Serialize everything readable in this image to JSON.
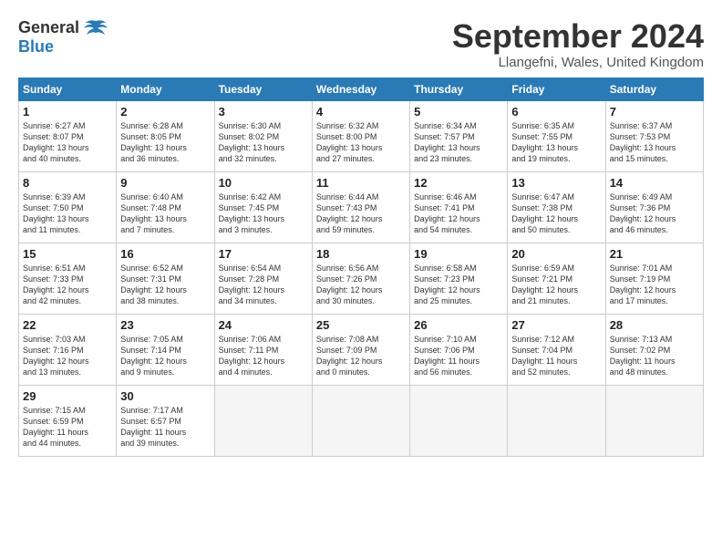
{
  "header": {
    "logo_general": "General",
    "logo_blue": "Blue",
    "month_title": "September 2024",
    "location": "Llangefni, Wales, United Kingdom"
  },
  "weekdays": [
    "Sunday",
    "Monday",
    "Tuesday",
    "Wednesday",
    "Thursday",
    "Friday",
    "Saturday"
  ],
  "weeks": [
    [
      {
        "day": "1",
        "lines": [
          "Sunrise: 6:27 AM",
          "Sunset: 8:07 PM",
          "Daylight: 13 hours",
          "and 40 minutes."
        ]
      },
      {
        "day": "2",
        "lines": [
          "Sunrise: 6:28 AM",
          "Sunset: 8:05 PM",
          "Daylight: 13 hours",
          "and 36 minutes."
        ]
      },
      {
        "day": "3",
        "lines": [
          "Sunrise: 6:30 AM",
          "Sunset: 8:02 PM",
          "Daylight: 13 hours",
          "and 32 minutes."
        ]
      },
      {
        "day": "4",
        "lines": [
          "Sunrise: 6:32 AM",
          "Sunset: 8:00 PM",
          "Daylight: 13 hours",
          "and 27 minutes."
        ]
      },
      {
        "day": "5",
        "lines": [
          "Sunrise: 6:34 AM",
          "Sunset: 7:57 PM",
          "Daylight: 13 hours",
          "and 23 minutes."
        ]
      },
      {
        "day": "6",
        "lines": [
          "Sunrise: 6:35 AM",
          "Sunset: 7:55 PM",
          "Daylight: 13 hours",
          "and 19 minutes."
        ]
      },
      {
        "day": "7",
        "lines": [
          "Sunrise: 6:37 AM",
          "Sunset: 7:53 PM",
          "Daylight: 13 hours",
          "and 15 minutes."
        ]
      }
    ],
    [
      {
        "day": "8",
        "lines": [
          "Sunrise: 6:39 AM",
          "Sunset: 7:50 PM",
          "Daylight: 13 hours",
          "and 11 minutes."
        ]
      },
      {
        "day": "9",
        "lines": [
          "Sunrise: 6:40 AM",
          "Sunset: 7:48 PM",
          "Daylight: 13 hours",
          "and 7 minutes."
        ]
      },
      {
        "day": "10",
        "lines": [
          "Sunrise: 6:42 AM",
          "Sunset: 7:45 PM",
          "Daylight: 13 hours",
          "and 3 minutes."
        ]
      },
      {
        "day": "11",
        "lines": [
          "Sunrise: 6:44 AM",
          "Sunset: 7:43 PM",
          "Daylight: 12 hours",
          "and 59 minutes."
        ]
      },
      {
        "day": "12",
        "lines": [
          "Sunrise: 6:46 AM",
          "Sunset: 7:41 PM",
          "Daylight: 12 hours",
          "and 54 minutes."
        ]
      },
      {
        "day": "13",
        "lines": [
          "Sunrise: 6:47 AM",
          "Sunset: 7:38 PM",
          "Daylight: 12 hours",
          "and 50 minutes."
        ]
      },
      {
        "day": "14",
        "lines": [
          "Sunrise: 6:49 AM",
          "Sunset: 7:36 PM",
          "Daylight: 12 hours",
          "and 46 minutes."
        ]
      }
    ],
    [
      {
        "day": "15",
        "lines": [
          "Sunrise: 6:51 AM",
          "Sunset: 7:33 PM",
          "Daylight: 12 hours",
          "and 42 minutes."
        ]
      },
      {
        "day": "16",
        "lines": [
          "Sunrise: 6:52 AM",
          "Sunset: 7:31 PM",
          "Daylight: 12 hours",
          "and 38 minutes."
        ]
      },
      {
        "day": "17",
        "lines": [
          "Sunrise: 6:54 AM",
          "Sunset: 7:28 PM",
          "Daylight: 12 hours",
          "and 34 minutes."
        ]
      },
      {
        "day": "18",
        "lines": [
          "Sunrise: 6:56 AM",
          "Sunset: 7:26 PM",
          "Daylight: 12 hours",
          "and 30 minutes."
        ]
      },
      {
        "day": "19",
        "lines": [
          "Sunrise: 6:58 AM",
          "Sunset: 7:23 PM",
          "Daylight: 12 hours",
          "and 25 minutes."
        ]
      },
      {
        "day": "20",
        "lines": [
          "Sunrise: 6:59 AM",
          "Sunset: 7:21 PM",
          "Daylight: 12 hours",
          "and 21 minutes."
        ]
      },
      {
        "day": "21",
        "lines": [
          "Sunrise: 7:01 AM",
          "Sunset: 7:19 PM",
          "Daylight: 12 hours",
          "and 17 minutes."
        ]
      }
    ],
    [
      {
        "day": "22",
        "lines": [
          "Sunrise: 7:03 AM",
          "Sunset: 7:16 PM",
          "Daylight: 12 hours",
          "and 13 minutes."
        ]
      },
      {
        "day": "23",
        "lines": [
          "Sunrise: 7:05 AM",
          "Sunset: 7:14 PM",
          "Daylight: 12 hours",
          "and 9 minutes."
        ]
      },
      {
        "day": "24",
        "lines": [
          "Sunrise: 7:06 AM",
          "Sunset: 7:11 PM",
          "Daylight: 12 hours",
          "and 4 minutes."
        ]
      },
      {
        "day": "25",
        "lines": [
          "Sunrise: 7:08 AM",
          "Sunset: 7:09 PM",
          "Daylight: 12 hours",
          "and 0 minutes."
        ]
      },
      {
        "day": "26",
        "lines": [
          "Sunrise: 7:10 AM",
          "Sunset: 7:06 PM",
          "Daylight: 11 hours",
          "and 56 minutes."
        ]
      },
      {
        "day": "27",
        "lines": [
          "Sunrise: 7:12 AM",
          "Sunset: 7:04 PM",
          "Daylight: 11 hours",
          "and 52 minutes."
        ]
      },
      {
        "day": "28",
        "lines": [
          "Sunrise: 7:13 AM",
          "Sunset: 7:02 PM",
          "Daylight: 11 hours",
          "and 48 minutes."
        ]
      }
    ],
    [
      {
        "day": "29",
        "lines": [
          "Sunrise: 7:15 AM",
          "Sunset: 6:59 PM",
          "Daylight: 11 hours",
          "and 44 minutes."
        ]
      },
      {
        "day": "30",
        "lines": [
          "Sunrise: 7:17 AM",
          "Sunset: 6:57 PM",
          "Daylight: 11 hours",
          "and 39 minutes."
        ]
      },
      {
        "day": "",
        "lines": []
      },
      {
        "day": "",
        "lines": []
      },
      {
        "day": "",
        "lines": []
      },
      {
        "day": "",
        "lines": []
      },
      {
        "day": "",
        "lines": []
      }
    ]
  ]
}
